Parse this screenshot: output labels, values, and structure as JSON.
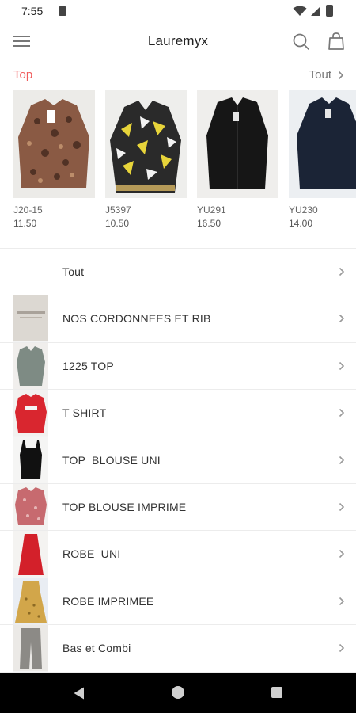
{
  "status": {
    "time": "7:55"
  },
  "app": {
    "title": "Lauremyx"
  },
  "featured": {
    "label": "Top",
    "see_all": "Tout",
    "products": [
      {
        "code": "J20-15",
        "price": "11.50"
      },
      {
        "code": "J5397",
        "price": "10.50"
      },
      {
        "code": "YU291",
        "price": "16.50"
      },
      {
        "code": "YU230",
        "price": "14.00"
      }
    ]
  },
  "categories": [
    {
      "name": "Tout"
    },
    {
      "name": "NOS CORDONNEES ET RIB"
    },
    {
      "name": "1225 TOP"
    },
    {
      "name": "T SHIRT"
    },
    {
      "name": "TOP  BLOUSE UNI"
    },
    {
      "name": "TOP BLOUSE IMPRIME"
    },
    {
      "name": "ROBE  UNI"
    },
    {
      "name": "ROBE IMPRIMEE"
    },
    {
      "name": "Bas et Combi"
    }
  ],
  "colors": {
    "accent": "#f05a5a",
    "text": "#333333",
    "divider": "#ececec",
    "navbar": "#000000"
  }
}
